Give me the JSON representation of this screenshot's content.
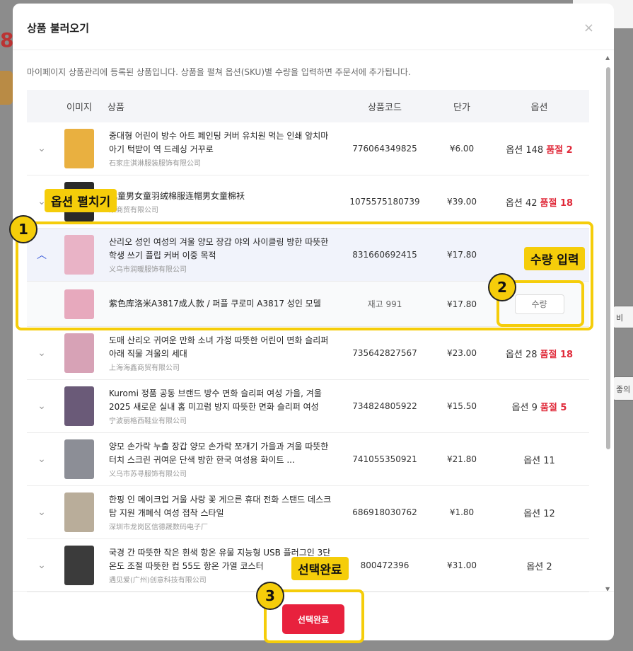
{
  "modal": {
    "title": "상품 불러오기",
    "close": "×",
    "description": "마이페이지 상품관리에 등록된 상품입니다. 상품을 펼쳐 옵션(SKU)별 수량을 입력하면 주문서에 추가됩니다.",
    "done_label": "선택완료"
  },
  "table": {
    "headers": {
      "image": "이미지",
      "product": "상품",
      "code": "상품코드",
      "price": "단가",
      "option": "옵션"
    },
    "rows": [
      {
        "name": "중대형 어린이 방수 아트 페인팅 커버 유치원 먹는 인쇄 앞치마 아기 턱받이 역 드레싱 거꾸로",
        "seller": "石家庄淇淋服装服饰有限公司",
        "code": "776064349825",
        "price": "¥6.00",
        "option": "옵션 148",
        "sold": "품절 2",
        "thumb_color": "#e9b040"
      },
      {
        "name": "儿童男女童羽绒棉服连帽男女童棉袄",
        "seller": "荣商贸有限公司",
        "code": "1075575180739",
        "price": "¥39.00",
        "option": "옵션 42",
        "sold": "품절 18",
        "thumb_color": "#2a2a2a"
      },
      {
        "name": "산리오 성인 여성의 겨울 양모 장갑 야외 사이클링 방한 따뜻한 학생 쓰기 플립 커버 이중 목적",
        "seller": "义乌市润暖服饰有限公司",
        "code": "831660692415",
        "price": "¥17.80",
        "option": "",
        "sold": "",
        "thumb_color": "#e9b3c6"
      },
      {
        "name": "도매 산리오 귀여운 만화 소녀 가정 따뜻한 어린이 면화 슬리퍼 아래 직물 겨울의 세대",
        "seller": "上海海鑫商贸有限公司",
        "code": "735642827567",
        "price": "¥23.00",
        "option": "옵션 28",
        "sold": "품절 18",
        "thumb_color": "#d7a2b6"
      },
      {
        "name": "Kuromi 정품 공동 브랜드 방수 면화 슬리퍼 여성 가을, 겨울 2025 새로운 실내 홈 미끄럼 방지 따뜻한 면화 슬리퍼 여성",
        "seller": "宁波丽格西鞋业有限公司",
        "code": "734824805922",
        "price": "¥15.50",
        "option": "옵션 9",
        "sold": "품절 5",
        "thumb_color": "#6a5a78"
      },
      {
        "name": "양모 손가락 누출 장갑 양모 손가락 쪼개기 가을과 겨울 따뜻한 터치 스크린 귀여운 단색 방한 한국 여성용 화이트 ...",
        "seller": "义乌市苏寻服饰有限公司",
        "code": "741055350921",
        "price": "¥21.80",
        "option": "옵션 11",
        "sold": "",
        "thumb_color": "#8c8e96"
      },
      {
        "name": "한핑 인 메이크업 거울 사랑 꽃 게으른 휴대 전화 스탠드 데스크탑 지원 개폐식 여성 접착 스타일",
        "seller": "深圳市龙岗区信德晟数码电子厂",
        "code": "686918030762",
        "price": "¥1.80",
        "option": "옵션 12",
        "sold": "",
        "thumb_color": "#b9ad9a"
      },
      {
        "name": "국경 간 따뜻한 작은 흰색 항온 유물 지능형 USB 플러그인 3단 온도 조절 따뜻한 컵 55도 항온 가열 코스터",
        "seller": "遇见爱(广州)创意科技有限公司",
        "code": "800472396",
        "price": "¥31.00",
        "option": "옵션 2",
        "sold": "",
        "thumb_color": "#3b3b3b"
      }
    ],
    "sku": {
      "name": "紫色库洛米A3817成人款 / 퍼플 쿠로미 A3817 성인 모델",
      "stock": "재고 991",
      "price": "¥17.80",
      "qty_placeholder": "수량",
      "thumb_color": "#e7a9bd"
    }
  },
  "overlay": {
    "step1": {
      "number": "1",
      "label": "옵션 펼치기"
    },
    "step2": {
      "number": "2",
      "label": "수량 입력"
    },
    "step3": {
      "number": "3",
      "label": "선택완료"
    },
    "color": "#f5cd0a"
  },
  "background": {
    "left_number": "8",
    "side_button_1": "비",
    "side_button_2": "좋의"
  }
}
